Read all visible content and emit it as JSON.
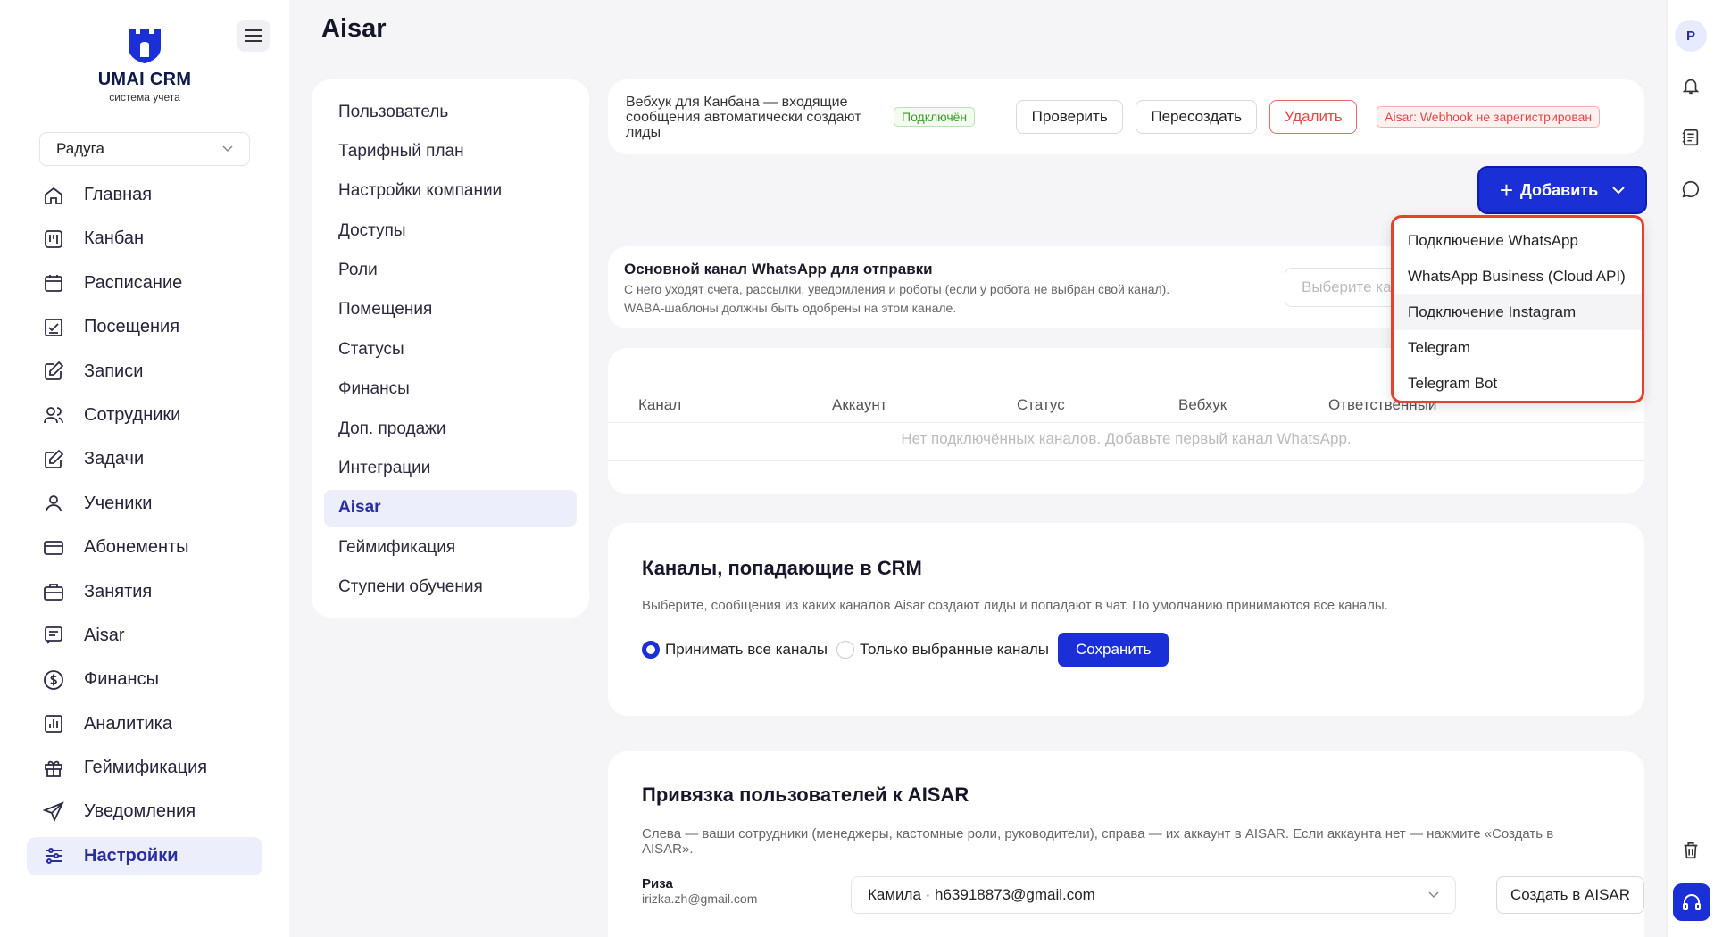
{
  "brand": {
    "name": "UMAI CRM",
    "tagline": "система учета"
  },
  "company_select": {
    "value": "Радуга"
  },
  "nav": [
    {
      "label": "Главная",
      "icon": "home-icon"
    },
    {
      "label": "Канбан",
      "icon": "kanban-icon"
    },
    {
      "label": "Расписание",
      "icon": "calendar-icon"
    },
    {
      "label": "Посещения",
      "icon": "checkin-icon"
    },
    {
      "label": "Записи",
      "icon": "edit-icon"
    },
    {
      "label": "Сотрудники",
      "icon": "users-icon"
    },
    {
      "label": "Задачи",
      "icon": "tasks-icon"
    },
    {
      "label": "Ученики",
      "icon": "user-icon"
    },
    {
      "label": "Абонементы",
      "icon": "card-icon"
    },
    {
      "label": "Занятия",
      "icon": "briefcase-icon"
    },
    {
      "label": "Aisar",
      "icon": "chat-icon"
    },
    {
      "label": "Финансы",
      "icon": "dollar-icon"
    },
    {
      "label": "Аналитика",
      "icon": "chart-icon"
    },
    {
      "label": "Геймификация",
      "icon": "gift-icon"
    },
    {
      "label": "Уведомления",
      "icon": "send-icon"
    },
    {
      "label": "Настройки",
      "icon": "sliders-icon",
      "active": true
    }
  ],
  "page_title": "Aisar",
  "settings_menu": [
    "Пользователь",
    "Тарифный план",
    "Настройки компании",
    "Доступы",
    "Роли",
    "Помещения",
    "Статусы",
    "Финансы",
    "Доп. продажи",
    "Интеграции",
    "Aisar",
    "Геймификация",
    "Ступени обучения"
  ],
  "settings_active": "Aisar",
  "webhook": {
    "text": "Вебхук для Канбана — входящие сообщения автоматически создают лиды",
    "status": "Подключён",
    "check": "Проверить",
    "recreate": "Пересоздать",
    "delete": "Удалить",
    "error": "Aisar: Webhook не зарегистрирован"
  },
  "add_button": {
    "label": "Добавить"
  },
  "add_menu": [
    "Подключение WhatsApp",
    "WhatsApp Business (Cloud API)",
    "Подключение Instagram",
    "Telegram",
    "Telegram Bot"
  ],
  "whatsapp_main": {
    "title": "Основной канал WhatsApp для отправки",
    "desc1": "С него уходят счета, рассылки, уведомления и роботы (если у робота не выбран свой канал).",
    "desc2": "WABA-шаблоны должны быть одобрены на этом канале.",
    "placeholder": "Выберите канал"
  },
  "channels_table": {
    "columns": [
      "Канал",
      "Аккаунт",
      "Статус",
      "Вебхук",
      "Ответственный"
    ],
    "empty": "Нет подключённых каналов. Добавьте первый канал WhatsApp."
  },
  "crm_channels": {
    "title": "Каналы, попадающие в CRM",
    "desc": "Выберите, сообщения из каких каналов Aisar создают лиды и попадают в чат. По умолчанию принимаются все каналы.",
    "option_all": "Принимать все каналы",
    "option_selected": "Только выбранные каналы",
    "save": "Сохранить",
    "selected": "all"
  },
  "user_binding": {
    "title": "Привязка пользователей к AISAR",
    "desc": "Слева — ваши сотрудники (менеджеры, кастомные роли, руководители), справа — их аккаунт в AISAR. Если аккаунта нет — нажмите «Создать в AISAR».",
    "rows": [
      {
        "name": "Риза",
        "email": "irizka.zh@gmail.com",
        "account": "Камила · h63918873@gmail.com",
        "create": "Создать в AISAR"
      }
    ]
  },
  "right_rail": {
    "avatar": "P"
  },
  "colors": {
    "accent": "#1a2fd6",
    "danger": "#e04848",
    "success": "#3b9b2d",
    "highlight": "#e5412f"
  }
}
